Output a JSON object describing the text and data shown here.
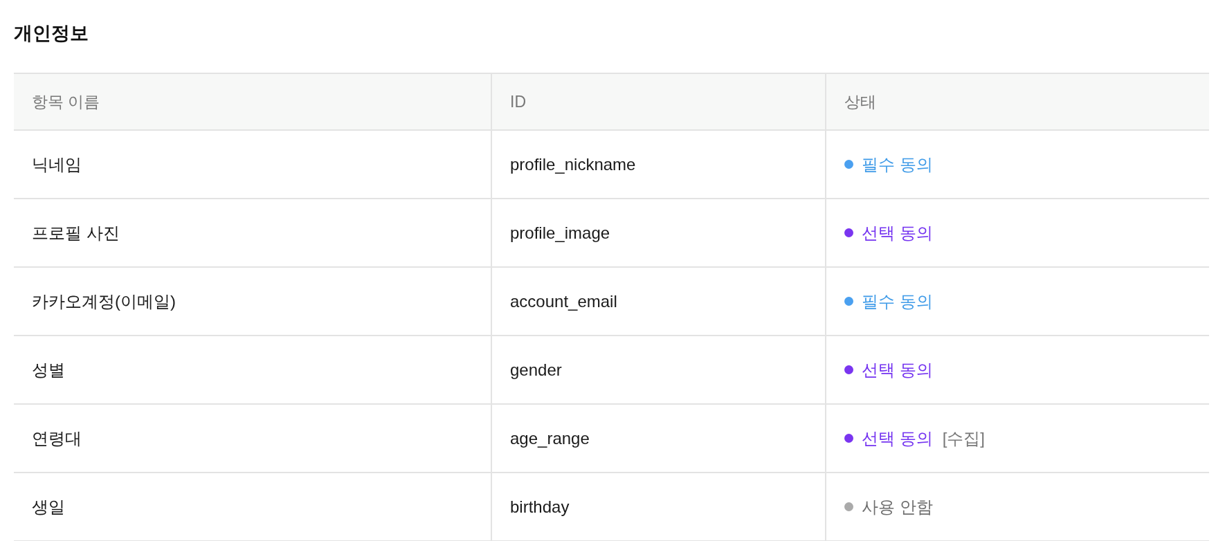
{
  "title": "개인정보",
  "table": {
    "columns": [
      "항목 이름",
      "ID",
      "상태"
    ],
    "rows": [
      {
        "name": "닉네임",
        "id": "profile_nickname",
        "status": {
          "kind": "required",
          "label": "필수 동의",
          "color": "#4aa0f0"
        }
      },
      {
        "name": "프로필 사진",
        "id": "profile_image",
        "status": {
          "kind": "optional",
          "label": "선택 동의",
          "color": "#7a35f0"
        }
      },
      {
        "name": "카카오계정(이메일)",
        "id": "account_email",
        "status": {
          "kind": "required",
          "label": "필수 동의",
          "color": "#4aa0f0"
        }
      },
      {
        "name": "성별",
        "id": "gender",
        "status": {
          "kind": "optional",
          "label": "선택 동의",
          "color": "#7a35f0"
        }
      },
      {
        "name": "연령대",
        "id": "age_range",
        "status": {
          "kind": "optional",
          "label": "선택 동의",
          "color": "#7a35f0",
          "note": "[수집]"
        }
      },
      {
        "name": "생일",
        "id": "birthday",
        "status": {
          "kind": "unused",
          "label": "사용 안함",
          "color": "#aaaaaa"
        }
      }
    ]
  }
}
